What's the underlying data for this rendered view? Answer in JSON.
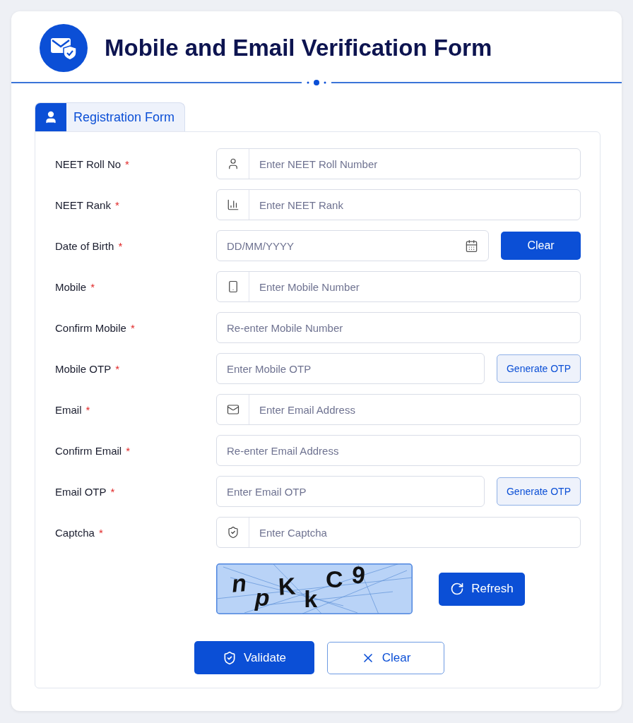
{
  "header": {
    "title": "Mobile and Email Verification Form"
  },
  "tabs": [
    {
      "label": "Registration Form",
      "selected": true
    }
  ],
  "fields": [
    {
      "kind": "addon",
      "label": "NEET Roll No",
      "required": true,
      "required_mark": "*",
      "placeholder": "Enter NEET Roll Number"
    },
    {
      "kind": "addon",
      "label": "NEET Rank",
      "required": true,
      "required_mark": "*",
      "placeholder": "Enter NEET Rank"
    },
    {
      "kind": "date",
      "label": "Date of Birth",
      "required": true,
      "required_mark": "*",
      "placeholder": "DD/MM/YYYY",
      "button": "Clear"
    },
    {
      "kind": "addon",
      "label": "Mobile",
      "required": true,
      "required_mark": "*",
      "placeholder": "Enter Mobile Number"
    },
    {
      "kind": "plain",
      "label": "Confirm Mobile",
      "required": true,
      "required_mark": "*",
      "placeholder": "Re-enter Mobile Number"
    },
    {
      "kind": "action",
      "label": "Mobile OTP",
      "required": true,
      "required_mark": "*",
      "placeholder": "Enter Mobile OTP",
      "button": "Generate OTP"
    },
    {
      "kind": "addon",
      "label": "Email",
      "required": true,
      "required_mark": "*",
      "placeholder": "Enter Email Address"
    },
    {
      "kind": "plain",
      "label": "Confirm Email",
      "required": true,
      "required_mark": "*",
      "placeholder": "Re-enter Email Address"
    },
    {
      "kind": "action",
      "label": "Email OTP",
      "required": true,
      "required_mark": "*",
      "placeholder": "Enter Email OTP",
      "button": "Generate OTP"
    },
    {
      "kind": "addon",
      "label": "Captcha",
      "required": true,
      "required_mark": "*",
      "placeholder": "Enter Captcha"
    }
  ],
  "captcha": {
    "characters": [
      "n",
      "p",
      "K",
      "k",
      "C",
      "9"
    ],
    "refresh_button": "Refresh"
  },
  "actions": {
    "validate": "Validate",
    "clear": "Clear"
  }
}
